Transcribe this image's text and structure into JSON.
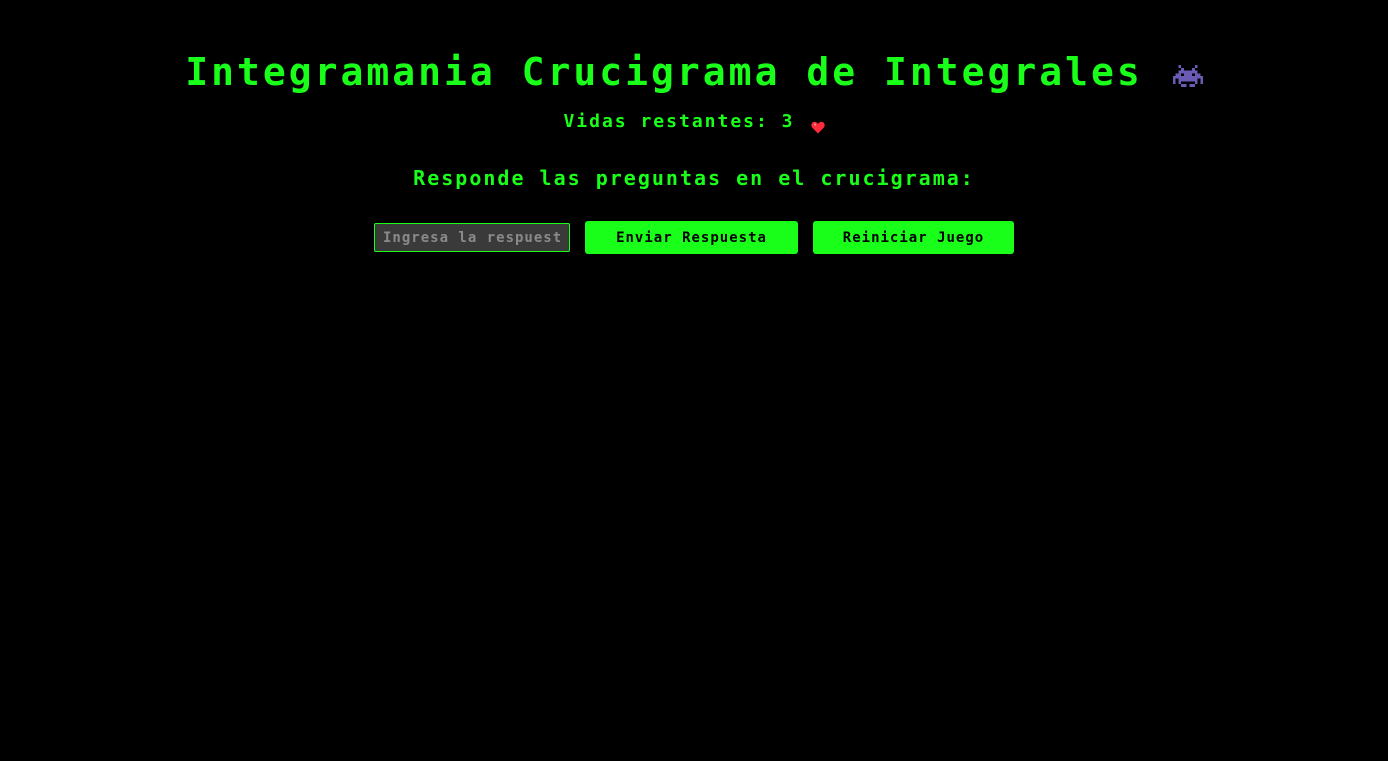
{
  "header": {
    "title": "Integramania Crucigrama de Integrales",
    "icon": "space-invader-icon",
    "icon_color": "#6b5bb5"
  },
  "status": {
    "lives_label": "Vidas restantes: 3",
    "lives": 3,
    "heart_icon": "heart-icon",
    "heart_color": "#ff2a3a"
  },
  "prompt": {
    "text": "Responde las preguntas en el crucigrama:"
  },
  "controls": {
    "answer_value": "",
    "answer_placeholder": "Ingresa la respuesta",
    "submit_label": "Enviar Respuesta",
    "reset_label": "Reiniciar Juego"
  },
  "theme": {
    "accent": "#1aff1a",
    "background": "#000000"
  }
}
